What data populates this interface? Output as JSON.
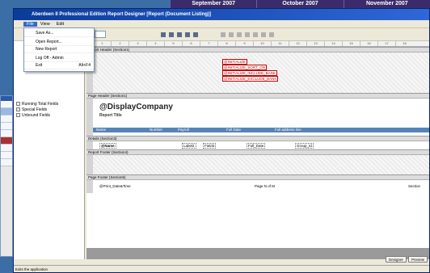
{
  "background_calendar": [
    "September 2007",
    "October 2007",
    "November 2007"
  ],
  "window": {
    "title": "Aberdeen II  Professional Edition  Report Designer  [Report  (Document Listing)]"
  },
  "menu": {
    "items": [
      "File",
      "View",
      "Edit"
    ],
    "active": "File"
  },
  "file_menu": [
    {
      "label": "Save As...",
      "shortcut": ""
    },
    {
      "label": "Open Report...",
      "shortcut": ""
    },
    {
      "label": "New Report",
      "shortcut": ""
    },
    {
      "label": "Log Off - Admin",
      "shortcut": ""
    },
    {
      "label": "Exit",
      "shortcut": "Alt+F4"
    }
  ],
  "tree": [
    {
      "label": "Running Total Fields"
    },
    {
      "label": "Special Fields"
    },
    {
      "label": "Unbound Fields"
    }
  ],
  "designer": {
    "ruler_ticks": [
      "1",
      "2",
      "3",
      "4",
      "5",
      "6",
      "7",
      "8",
      "9",
      "10",
      "11",
      "12",
      "13",
      "14",
      "15",
      "16",
      "17",
      "18"
    ],
    "report_header": {
      "section_label": "Report Header (Section1)",
      "fields": [
        "@INITIALIZE",
        "@INITIALIZE_SORT_ON",
        "@INITIALIZE_INCLUDE_BANK",
        "@INITIALIZE_EXCLUDE_BANK"
      ]
    },
    "page_header": {
      "section_label": "Page Header (Section1)",
      "company": "@DisplayCompany",
      "report_title": "Report Title",
      "columns": [
        "Name",
        "Number",
        "Payroll",
        "Full Date",
        "Full address line"
      ]
    },
    "details": {
      "section_label": "Details (Section3)",
      "fields": [
        "@Name",
        "Label2",
        "Field4",
        "Full_Date",
        "Group_Id"
      ]
    },
    "report_footer": {
      "section_label": "Report Footer (Section4)"
    },
    "page_footer": {
      "section_label": "Page Footer (Section5)",
      "left": "@Print_Date&Time",
      "middle": "Page N of M",
      "right": "Section"
    }
  },
  "buttons": {
    "preview": "Designer",
    "close": "Preview"
  },
  "status": "Exits the application"
}
